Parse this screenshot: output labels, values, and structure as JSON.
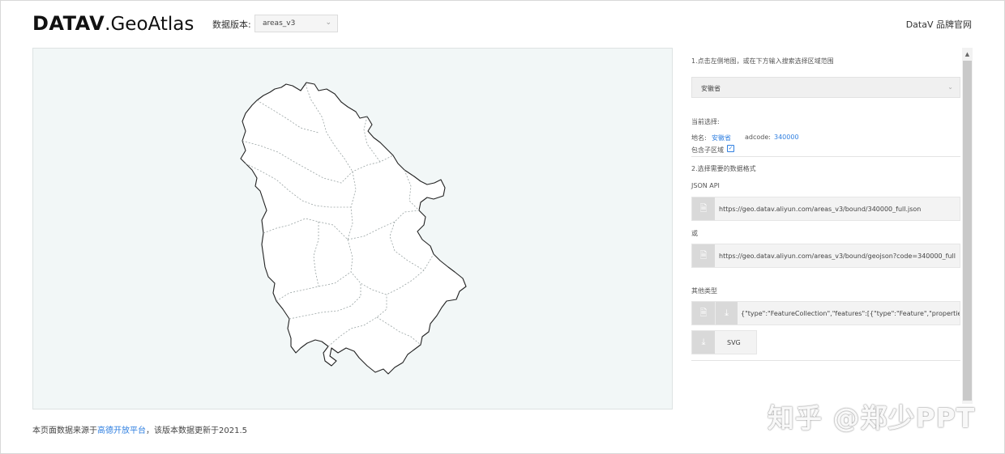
{
  "header": {
    "logo_bold": "DATAV",
    "logo_light": ".GeoAtlas",
    "version_label": "数据版本:",
    "version_value": "areas_v3",
    "brand_link": "DataV 品牌官网"
  },
  "panel": {
    "step1": "1.点击左侧地图，或在下方输入搜索选择区域范围",
    "region_select": "安徽省",
    "current_label": "当前选择:",
    "name_label": "地名:",
    "name_value": "安徽省",
    "adcode_label": "adcode:",
    "adcode_value": "340000",
    "include_sub_label": "包含子区域",
    "include_sub_checked": true,
    "step2": "2.选择需要的数据格式",
    "json_api_label": "JSON API",
    "url1": "https://geo.datav.aliyun.com/areas_v3/bound/340000_full.json",
    "or_label": "或",
    "url2": "https://geo.datav.aliyun.com/areas_v3/bound/geojson?code=340000_full",
    "other_label": "其他类型",
    "geojson_preview": "{\"type\":\"FeatureCollection\",\"features\":[{\"type\":\"Feature\",\"properties\":{\"adcode\":",
    "svg_label": "SVG"
  },
  "footer": {
    "prefix": "本页面数据来源于",
    "link": "高德开放平台",
    "suffix": "，该版本数据更新于2021.5"
  },
  "watermark": "知乎 @郑少PPT",
  "colors": {
    "link": "#2f7fe0",
    "map_bg": "#f2f7f7",
    "map_stroke": "#222222",
    "icon_bg": "#d9d9d9"
  }
}
